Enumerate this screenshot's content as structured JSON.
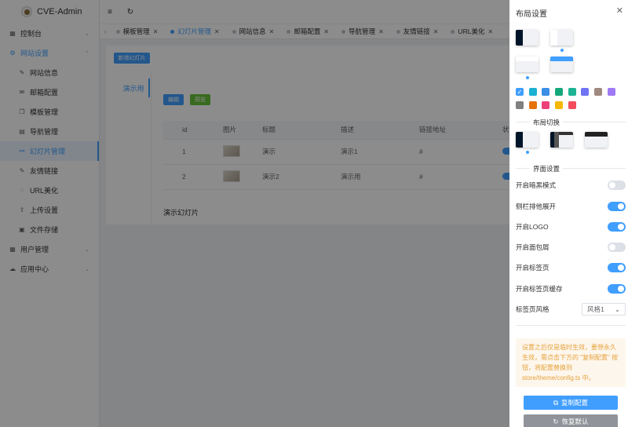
{
  "app": {
    "title": "CVE-Admin"
  },
  "sidebar": {
    "items": [
      {
        "label": "控制台",
        "icon": "dashboard-icon",
        "arrow": "⌄",
        "type": "group"
      },
      {
        "label": "网站设置",
        "icon": "settings-icon",
        "arrow": "⌃",
        "type": "group-open"
      },
      {
        "label": "网站信息",
        "icon": "edit-icon",
        "type": "sub"
      },
      {
        "label": "邮箱配置",
        "icon": "mail-icon",
        "type": "sub"
      },
      {
        "label": "模板管理",
        "icon": "copy-icon",
        "type": "sub"
      },
      {
        "label": "导航管理",
        "icon": "document-icon",
        "type": "sub"
      },
      {
        "label": "幻灯片管理",
        "icon": "link-icon",
        "type": "sub-active"
      },
      {
        "label": "友情链接",
        "icon": "edit-icon",
        "type": "sub"
      },
      {
        "label": "URL美化",
        "icon": "eleme-icon",
        "type": "sub"
      },
      {
        "label": "上传设置",
        "icon": "upload-icon",
        "type": "sub"
      },
      {
        "label": "文件存储",
        "icon": "files-icon",
        "type": "sub"
      },
      {
        "label": "用户管理",
        "icon": "users-icon",
        "arrow": "⌄",
        "type": "group"
      },
      {
        "label": "应用中心",
        "icon": "cloud-icon",
        "arrow": "⌄",
        "type": "group"
      }
    ]
  },
  "header": {
    "collapse_icon": "≡",
    "refresh_icon": "↻"
  },
  "tabs": {
    "items": [
      {
        "label": "模板管理",
        "active": false
      },
      {
        "label": "幻灯片管理",
        "active": true
      },
      {
        "label": "网站信息",
        "active": false
      },
      {
        "label": "邮箱配置",
        "active": false
      },
      {
        "label": "导航管理",
        "active": false
      },
      {
        "label": "友情链接",
        "active": false
      },
      {
        "label": "URL美化",
        "active": false
      }
    ]
  },
  "main": {
    "add_button": "新增幻灯片",
    "side_tab": "演示用",
    "edit_button": "编辑",
    "preview_button": "预览",
    "columns": [
      "id",
      "图片",
      "标题",
      "描述",
      "链接地址",
      "状"
    ],
    "rows": [
      {
        "id": "1",
        "title": "演示",
        "desc": "演示1",
        "link": "#"
      },
      {
        "id": "2",
        "title": "演示2",
        "desc": "演示用",
        "link": "#"
      }
    ],
    "caption": "演示幻灯片"
  },
  "drawer": {
    "title": "布局设置",
    "close": "✕",
    "colors": [
      "#409eff",
      "#1ab1d2",
      "#3a8ee6",
      "#13a87a",
      "#1bb394",
      "#6f74f7",
      "#a1887f",
      "#a07af5",
      "#808080",
      "#e6720a",
      "#ec407a",
      "#f5b800",
      "#f14c5b"
    ],
    "check": "✓",
    "layout_switch_label": "布局切换",
    "interface_label": "界面设置",
    "settings": [
      {
        "label": "开启暗黑模式",
        "on": false
      },
      {
        "label": "侧栏排他展开",
        "on": true
      },
      {
        "label": "开启LOGO",
        "on": true
      },
      {
        "label": "开启面包屑",
        "on": false
      },
      {
        "label": "开启标签页",
        "on": true
      },
      {
        "label": "开启标签页缓存",
        "on": true
      }
    ],
    "tab_style_label": "标签页风格",
    "tab_style_value": "风格1",
    "notice": "设置之后仅是临时生效，要想永久生效，需点击下方的 \"复制配置\" 按钮，将配置替换到 store/theme/config.ts 中。",
    "copy_button": "复制配置",
    "reset_button": "恢复默认"
  }
}
